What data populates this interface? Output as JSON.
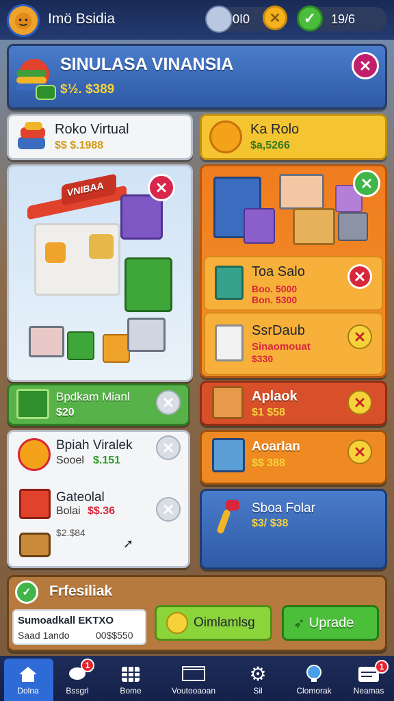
{
  "topbar": {
    "title": "Imö Bsidia",
    "stat1": "0I0",
    "stat2": "19/6"
  },
  "header": {
    "title": "SINULASA VINANSIA",
    "amount": "$½. $389"
  },
  "left_top": {
    "title": "Roko Virtual",
    "price": "$$ $.1988"
  },
  "right_top": {
    "title": "Ka Rolo",
    "price": "$a,5266"
  },
  "store_banner": "VNIBAA",
  "green_card": {
    "title": "Bpdkam Mianl",
    "price": "$20"
  },
  "white_items": [
    {
      "title": "Bpiah Viralek",
      "sub": "Sooel",
      "price": "$.151"
    },
    {
      "title": "Gateolal",
      "sub": "Bolai",
      "price": "$$.36"
    },
    {
      "title": "",
      "sub": "",
      "price": "$2.$84"
    }
  ],
  "orange_items": [
    {
      "title": "Toa Salo",
      "line1": "Boo. 5000",
      "line2": "Bon. 5300"
    },
    {
      "title": "SsrDaub",
      "line1": "Sinaomouat",
      "line2": "$330"
    }
  ],
  "right_cards": [
    {
      "title": "Aplaok",
      "price": "$1 $58"
    },
    {
      "title": "Aoarlan",
      "price": "$$ 388"
    },
    {
      "title": "Sboa Folar",
      "price": "$3/ $38"
    }
  ],
  "bottom": {
    "title": "Frfesiliak",
    "box_line1": "Sumoadkall EKTXO",
    "box_line2a": "Saad 1ando",
    "box_line2b": "00$$550",
    "btn_left": "Oimlamlsg",
    "btn_right": "Uprade"
  },
  "nav": [
    {
      "label": "Dolna",
      "badge": ""
    },
    {
      "label": "Bssgrl",
      "badge": "1"
    },
    {
      "label": "Bome",
      "badge": ""
    },
    {
      "label": "Voutooaoan",
      "badge": ""
    },
    {
      "label": "Sil",
      "badge": ""
    },
    {
      "label": "Clomorak",
      "badge": ""
    },
    {
      "label": "Neamas",
      "badge": "1"
    }
  ],
  "colors": {
    "header_blue": "#3a67b4",
    "card_yellow": "#f5c431",
    "card_orange": "#ef8a22",
    "card_red": "#d8502a",
    "card_green": "#58b24a",
    "price_green": "#2f9a2a",
    "price_red": "#d8263b"
  }
}
